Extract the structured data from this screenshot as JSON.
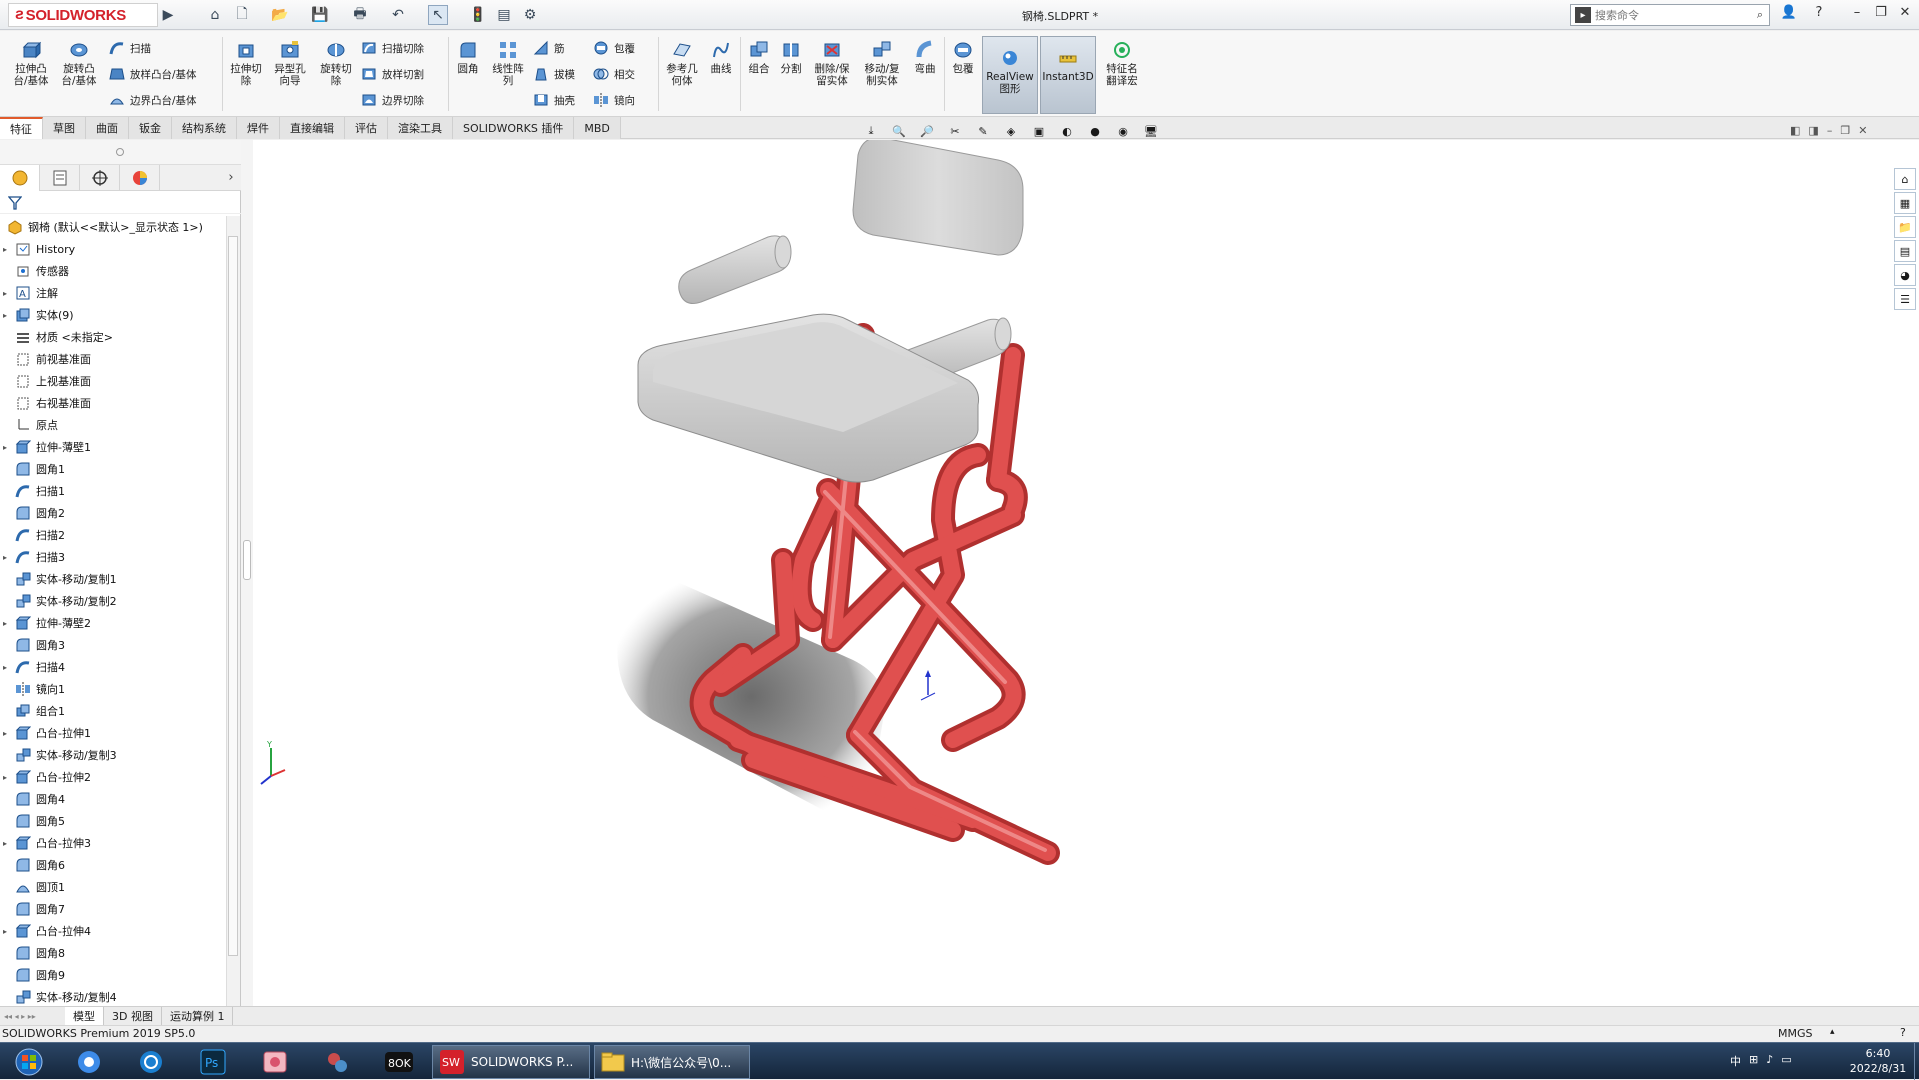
{
  "titlebar": {
    "logo": "SOLIDWORKS",
    "doc_title": "钢椅.SLDPRT *",
    "search_placeholder": "搜索命令"
  },
  "ribbon": {
    "extrude_boss": "拉伸凸\n台/基体",
    "revolve_boss": "旋转凸\n台/基体",
    "sweep": "扫描",
    "loft_boss": "放样凸台/基体",
    "boundary_boss": "边界凸台/基体",
    "extrude_cut": "拉伸切\n除",
    "hole_wizard": "异型孔\n向导",
    "revolve_cut": "旋转切\n除",
    "swept_cut": "扫描切除",
    "lofted_cut": "放样切割",
    "boundary_cut": "边界切除",
    "fillet": "圆角",
    "linear_pattern": "线性阵\n列",
    "rib": "筋",
    "draft": "拔模",
    "shell": "抽壳",
    "wrap": "包覆",
    "intersect": "相交",
    "mirror": "镜向",
    "ref_geometry": "参考几\n何体",
    "curves": "曲线",
    "combine": "组合",
    "split": "分割",
    "delete_keep": "删除/保\n留实体",
    "move_copy": "移动/复\n制实体",
    "flex": "弯曲",
    "wrap2": "包覆",
    "realview": "RealView\n图形",
    "instant3d": "Instant3D",
    "feature_translate": "特征名\n翻译宏"
  },
  "tabs": [
    "特征",
    "草图",
    "曲面",
    "钣金",
    "结构系统",
    "焊件",
    "直接编辑",
    "评估",
    "渲染工具",
    "SOLIDWORKS 插件",
    "MBD"
  ],
  "tree": {
    "root": "钢椅 (默认<<默认>_显示状态 1>)",
    "items": [
      {
        "label": "History",
        "arrow": true,
        "icon": "history-icon"
      },
      {
        "label": "传感器",
        "arrow": false,
        "icon": "sensor-icon"
      },
      {
        "label": "注解",
        "arrow": true,
        "icon": "annotation-icon"
      },
      {
        "label": "实体(9)",
        "arrow": true,
        "icon": "solid-bodies-icon"
      },
      {
        "label": "材质 <未指定>",
        "arrow": false,
        "icon": "material-icon"
      },
      {
        "label": "前视基准面",
        "arrow": false,
        "icon": "plane-icon"
      },
      {
        "label": "上视基准面",
        "arrow": false,
        "icon": "plane-icon"
      },
      {
        "label": "右视基准面",
        "arrow": false,
        "icon": "plane-icon"
      },
      {
        "label": "原点",
        "arrow": false,
        "icon": "origin-icon"
      },
      {
        "label": "拉伸-薄壁1",
        "arrow": true,
        "icon": "extrude-icon"
      },
      {
        "label": "圆角1",
        "arrow": false,
        "icon": "fillet-icon"
      },
      {
        "label": "扫描1",
        "arrow": false,
        "icon": "sweep-icon"
      },
      {
        "label": "圆角2",
        "arrow": false,
        "icon": "fillet-icon"
      },
      {
        "label": "扫描2",
        "arrow": false,
        "icon": "sweep-icon"
      },
      {
        "label": "扫描3",
        "arrow": true,
        "icon": "sweep-icon"
      },
      {
        "label": "实体-移动/复制1",
        "arrow": false,
        "icon": "move-copy-icon"
      },
      {
        "label": "实体-移动/复制2",
        "arrow": false,
        "icon": "move-copy-icon"
      },
      {
        "label": "拉伸-薄壁2",
        "arrow": true,
        "icon": "extrude-icon"
      },
      {
        "label": "圆角3",
        "arrow": false,
        "icon": "fillet-icon"
      },
      {
        "label": "扫描4",
        "arrow": true,
        "icon": "sweep-icon"
      },
      {
        "label": "镜向1",
        "arrow": false,
        "icon": "mirror-icon"
      },
      {
        "label": "组合1",
        "arrow": false,
        "icon": "combine-icon"
      },
      {
        "label": "凸台-拉伸1",
        "arrow": true,
        "icon": "extrude-icon"
      },
      {
        "label": "实体-移动/复制3",
        "arrow": false,
        "icon": "move-copy-icon"
      },
      {
        "label": "凸台-拉伸2",
        "arrow": true,
        "icon": "extrude-icon"
      },
      {
        "label": "圆角4",
        "arrow": false,
        "icon": "fillet-icon"
      },
      {
        "label": "圆角5",
        "arrow": false,
        "icon": "fillet-icon"
      },
      {
        "label": "凸台-拉伸3",
        "arrow": true,
        "icon": "extrude-icon"
      },
      {
        "label": "圆角6",
        "arrow": false,
        "icon": "fillet-icon"
      },
      {
        "label": "圆顶1",
        "arrow": false,
        "icon": "dome-icon"
      },
      {
        "label": "圆角7",
        "arrow": false,
        "icon": "fillet-icon"
      },
      {
        "label": "凸台-拉伸4",
        "arrow": true,
        "icon": "extrude-icon"
      },
      {
        "label": "圆角8",
        "arrow": false,
        "icon": "fillet-icon"
      },
      {
        "label": "圆角9",
        "arrow": false,
        "icon": "fillet-icon"
      },
      {
        "label": "实体-移动/复制4",
        "arrow": false,
        "icon": "move-copy-icon"
      }
    ]
  },
  "bottom_tabs": [
    "模型",
    "3D 视图",
    "运动算例 1"
  ],
  "status": {
    "product": "SOLIDWORKS Premium 2019 SP5.0",
    "units": "MMGS"
  },
  "taskbar": {
    "sw_label": "SOLIDWORKS P...",
    "folder_label": "H:\\微信公众号\\0...",
    "time": "6:40",
    "date": "2022/8/31"
  },
  "colors": {
    "frame_red": "#e0504f",
    "cushion_gray": "#c9c9c9",
    "brand_red": "#d4212b"
  }
}
